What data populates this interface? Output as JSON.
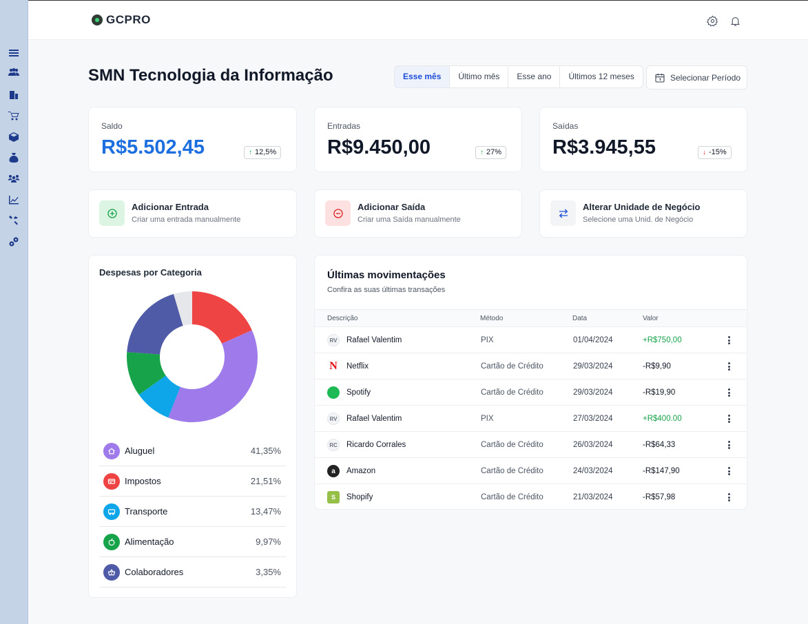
{
  "app": {
    "logo_text": "GCPRO"
  },
  "sidebar": {
    "items": [
      {
        "name": "menu-icon"
      },
      {
        "name": "users-icon"
      },
      {
        "name": "building-icon"
      },
      {
        "name": "cart-icon"
      },
      {
        "name": "box-icon"
      },
      {
        "name": "money-bag-icon"
      },
      {
        "name": "team-icon"
      },
      {
        "name": "chart-icon"
      },
      {
        "name": "tools-icon"
      },
      {
        "name": "gears-icon"
      }
    ]
  },
  "page": {
    "title": "SMN Tecnologia da Informação",
    "period_tabs": [
      "Esse mês",
      "Último mês",
      "Esse ano",
      "Últimos 12 meses"
    ],
    "active_tab": "Esse mês",
    "period_button": "Selecionar Período"
  },
  "stats": [
    {
      "label": "Saldo",
      "value": "R$5.502,45",
      "change": "12,5%",
      "direction": "up"
    },
    {
      "label": "Entradas",
      "value": "R$9.450,00",
      "change": "27%",
      "direction": "up"
    },
    {
      "label": "Saídas",
      "value": "R$3.945,55",
      "change": "-15%",
      "direction": "down"
    }
  ],
  "actions": [
    {
      "title": "Adicionar Entrada",
      "subtitle": "Criar uma entrada manualmente"
    },
    {
      "title": "Adicionar Saída",
      "subtitle": "Criar uma Saída manualmente"
    },
    {
      "title": "Alterar Unidade de Negócio",
      "subtitle": "Selecione uma Unid. de Negócio"
    }
  ],
  "categories": {
    "title": "Despesas por Categoria",
    "items": [
      {
        "name": "Aluguel",
        "pct": "41,35%",
        "color": "#9f7aea"
      },
      {
        "name": "Impostos",
        "pct": "21,51%",
        "color": "#ef4444"
      },
      {
        "name": "Transporte",
        "pct": "13,47%",
        "color": "#0ea5e9"
      },
      {
        "name": "Alimentação",
        "pct": "9,97%",
        "color": "#16a34a"
      },
      {
        "name": "Colaboradores",
        "pct": "3,35%",
        "color": "#4f5ba6"
      }
    ]
  },
  "chart_data": {
    "type": "pie",
    "title": "Despesas por Categoria",
    "slices": [
      {
        "label": "Impostos",
        "value": 20,
        "color": "#ef4444"
      },
      {
        "label": "Aluguel",
        "value": 41,
        "color": "#9f7aea"
      },
      {
        "label": "Transporte",
        "value": 10,
        "color": "#0ea5e9"
      },
      {
        "label": "Alimentação",
        "value": 12,
        "color": "#16a34a"
      },
      {
        "label": "Colaboradores",
        "value": 21,
        "color": "#4f5ba6"
      },
      {
        "label": "",
        "value": 5,
        "color": "#e5e7eb"
      }
    ]
  },
  "transactions": {
    "title": "Últimas movimentações",
    "subtitle": "Confira as suas últimas transações",
    "columns": [
      "Descrição",
      "Método",
      "Data",
      "Valor"
    ],
    "rows": [
      {
        "avatar": "RV",
        "type": "initials",
        "desc": "Rafael Valentim",
        "method": "PIX",
        "date": "01/04/2024",
        "value": "+R$750,00",
        "positive": true
      },
      {
        "avatar": "N",
        "type": "netflix",
        "desc": "Netflix",
        "method": "Cartão de Crédito",
        "date": "29/03/2024",
        "value": "-R$9,90",
        "positive": false
      },
      {
        "avatar": "",
        "type": "spotify",
        "desc": "Spotify",
        "method": "Cartão de Crédito",
        "date": "29/03/2024",
        "value": "-R$19,90",
        "positive": false
      },
      {
        "avatar": "RV",
        "type": "initials",
        "desc": "Rafael Valentim",
        "method": "PIX",
        "date": "27/03/2024",
        "value": "+R$400.00",
        "positive": true
      },
      {
        "avatar": "RC",
        "type": "initials",
        "desc": "Ricardo Corrales",
        "method": "Cartão de Crédito",
        "date": "26/03/2024",
        "value": "-R$64,33",
        "positive": false
      },
      {
        "avatar": "a",
        "type": "amazon",
        "desc": "Amazon",
        "method": "Cartão de Crédito",
        "date": "24/03/2024",
        "value": "-R$147,90",
        "positive": false
      },
      {
        "avatar": "S",
        "type": "shopify",
        "desc": "Shopify",
        "method": "Cartão de Crédito",
        "date": "21/03/2024",
        "value": "-R$57,98",
        "positive": false
      }
    ]
  }
}
